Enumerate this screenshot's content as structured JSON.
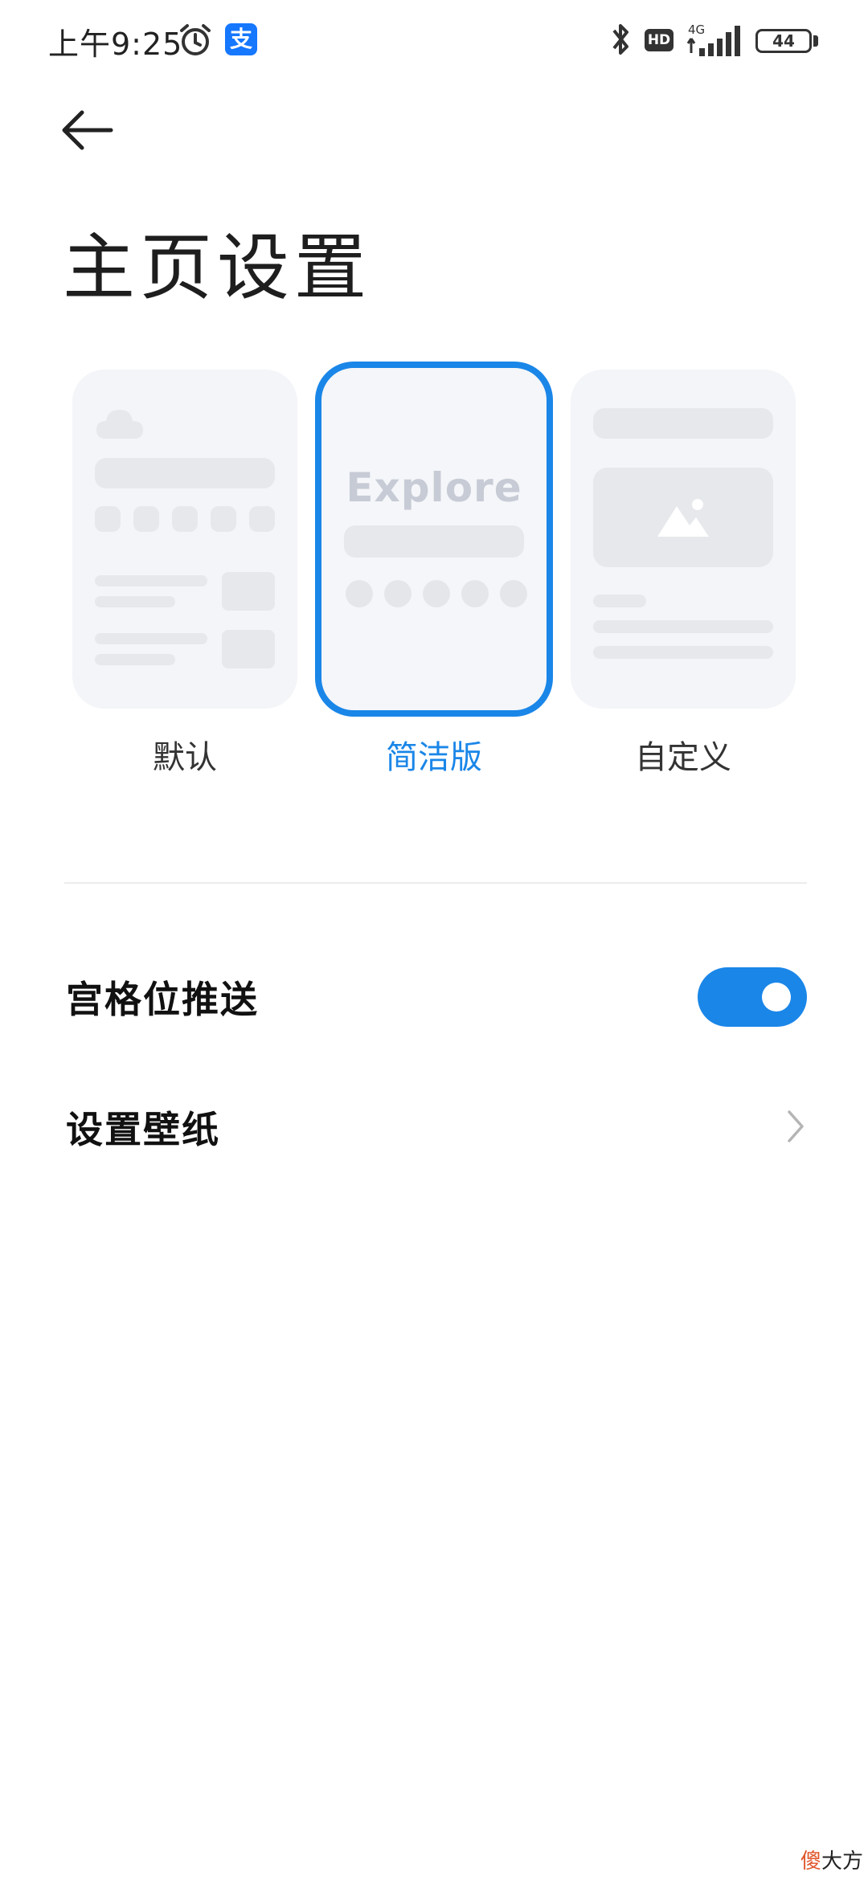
{
  "status_bar": {
    "time": "上午9:25",
    "alipay_glyph": "支",
    "hd": "HD",
    "network": "4G",
    "battery": "44",
    "icons": [
      "alarm-icon",
      "alipay-icon",
      "bluetooth-icon",
      "hd-icon",
      "signal-icon",
      "battery-icon"
    ]
  },
  "header": {
    "title": "主页设置",
    "back_icon": "arrow-left-icon"
  },
  "layouts": {
    "options": [
      {
        "label": "默认"
      },
      {
        "label": "简洁版",
        "selected": true,
        "preview_text": "Explore"
      },
      {
        "label": "自定义"
      }
    ],
    "accent": "#1a86e8"
  },
  "settings": {
    "grid_push": {
      "label": "宫格位推送",
      "enabled": true
    },
    "wallpaper": {
      "label": "设置壁纸",
      "chevron_icon": "chevron-right-icon"
    }
  },
  "watermark": {
    "part1": "傻",
    "part2": "大方"
  }
}
